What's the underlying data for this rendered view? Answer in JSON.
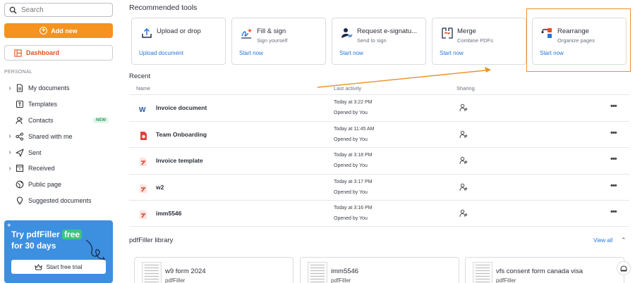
{
  "sidebar": {
    "search_placeholder": "Search",
    "add_new": "Add new",
    "dashboard": "Dashboard",
    "section_label": "PERSONAL",
    "items": [
      {
        "label": "My documents",
        "chevron": true,
        "icon": "document-icon"
      },
      {
        "label": "Templates",
        "chevron": false,
        "icon": "template-icon"
      },
      {
        "label": "Contacts",
        "chevron": false,
        "icon": "contacts-icon",
        "badge": "NEW"
      },
      {
        "label": "Shared with me",
        "chevron": true,
        "icon": "share-icon"
      },
      {
        "label": "Sent",
        "chevron": true,
        "icon": "send-icon"
      },
      {
        "label": "Received",
        "chevron": true,
        "icon": "inbox-icon"
      },
      {
        "label": "Public page",
        "chevron": false,
        "icon": "globe-icon"
      },
      {
        "label": "Suggested documents",
        "chevron": false,
        "icon": "lightbulb-icon"
      }
    ],
    "promo": {
      "line1_prefix": "Try pdfFiller ",
      "line1_highlight": "free",
      "line2": "for 30 days",
      "button": "Start free trial"
    }
  },
  "recommended": {
    "title": "Recommended tools",
    "tools": [
      {
        "name": "Upload or drop",
        "sub": "",
        "link": "Upload document",
        "icon": "upload-icon"
      },
      {
        "name": "Fill & sign",
        "sub": "Sign yourself",
        "link": "Start now",
        "icon": "fill-sign-icon"
      },
      {
        "name": "Request e-signatu...",
        "sub": "Send to sign",
        "link": "Start now",
        "icon": "request-signature-icon"
      },
      {
        "name": "Merge",
        "sub": "Combine PDFs",
        "link": "Start now",
        "icon": "merge-icon"
      },
      {
        "name": "Rearrange",
        "sub": "Organize pages",
        "link": "Start now",
        "icon": "rearrange-icon"
      }
    ]
  },
  "recent": {
    "title": "Recent",
    "columns": [
      "Name",
      "Last activity",
      "Sharing"
    ],
    "rows": [
      {
        "name": "Invoice document",
        "time": "Today at 3:22 PM",
        "opened": "Opened by You",
        "type": "word"
      },
      {
        "name": "Team Onboarding",
        "time": "Today at 11:45 AM",
        "opened": "Opened by You",
        "type": "form"
      },
      {
        "name": "Invoice template",
        "time": "Today at 3:18 PM",
        "opened": "Opened by You",
        "type": "pdf"
      },
      {
        "name": "w2",
        "time": "Today at 3:17 PM",
        "opened": "Opened by You",
        "type": "pdf"
      },
      {
        "name": "imm5546",
        "time": "Today at 3:16 PM",
        "opened": "Opened by You",
        "type": "pdf"
      }
    ]
  },
  "library": {
    "title": "pdfFiller library",
    "view_all": "View all",
    "items": [
      {
        "name": "w9 form 2024",
        "source": "pdfFiller"
      },
      {
        "name": "imm5546",
        "source": "pdfFiller"
      },
      {
        "name": "vfs consent form canada visa",
        "source": "pdfFiller"
      }
    ]
  },
  "colors": {
    "accent": "#f6921e",
    "link": "#2676d9",
    "highlight": "#e8922a",
    "promo": "#3d8fe0"
  }
}
